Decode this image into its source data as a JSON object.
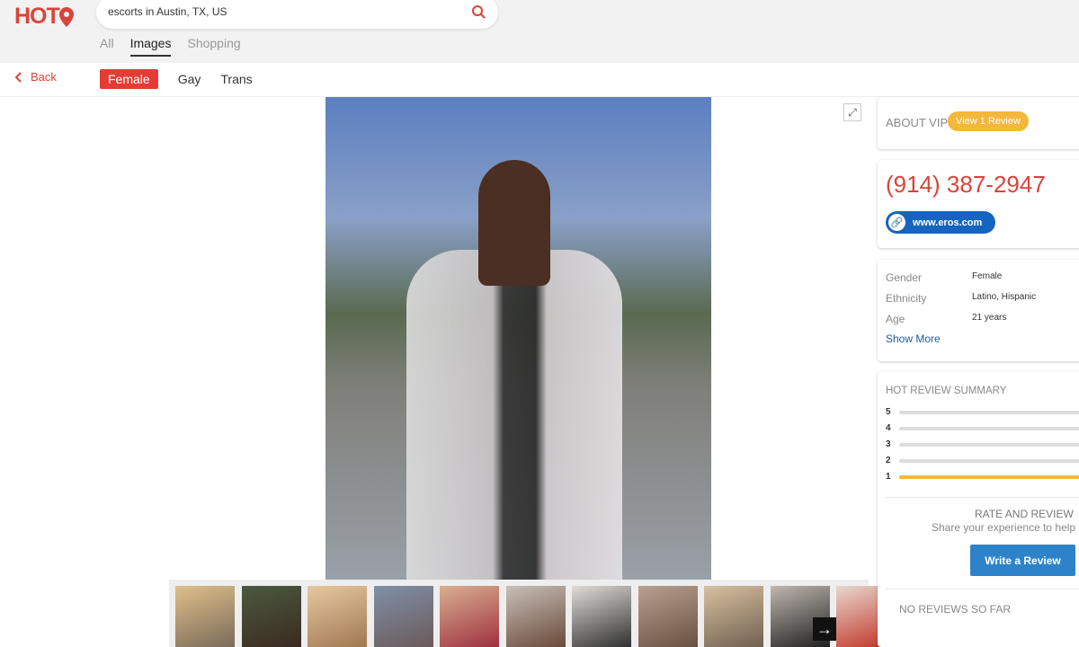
{
  "header": {
    "logo": "HOT",
    "search_value": "escorts in Austin, TX, US",
    "tabs": [
      {
        "label": "All"
      },
      {
        "label": "Images",
        "active": true
      },
      {
        "label": "Shopping"
      }
    ]
  },
  "subnav": {
    "back": "Back",
    "filters": [
      {
        "label": "Female",
        "active": true
      },
      {
        "label": "Gay"
      },
      {
        "label": "Trans"
      }
    ]
  },
  "gallery": {
    "thumbnail_count": 12
  },
  "about": {
    "title": "ABOUT VIP",
    "review_button": "View 1 Review"
  },
  "contact": {
    "phone": "(914) 387-2947",
    "website": "www.eros.com"
  },
  "details": {
    "rows": [
      {
        "key": "Gender",
        "value": "Female"
      },
      {
        "key": "Ethnicity",
        "value": "Latino, Hispanic"
      },
      {
        "key": "Age",
        "value": "21 years"
      }
    ],
    "show_more": "Show More"
  },
  "reviews": {
    "title": "HOT REVIEW SUMMARY",
    "ratings": [
      {
        "star": "5",
        "fraction": 0
      },
      {
        "star": "4",
        "fraction": 0
      },
      {
        "star": "3",
        "fraction": 0
      },
      {
        "star": "2",
        "fraction": 0
      },
      {
        "star": "1",
        "fraction": 1
      }
    ],
    "rate_title": "RATE AND REVIEW",
    "rate_sub": "Share your experience to help",
    "write_button": "Write a Review",
    "empty": "NO REVIEWS SO FAR"
  },
  "colors": {
    "brand": "#d9443a",
    "link_blue": "#1565c0",
    "review_yellow": "#f3b73a",
    "button_blue": "#2d83c9"
  }
}
